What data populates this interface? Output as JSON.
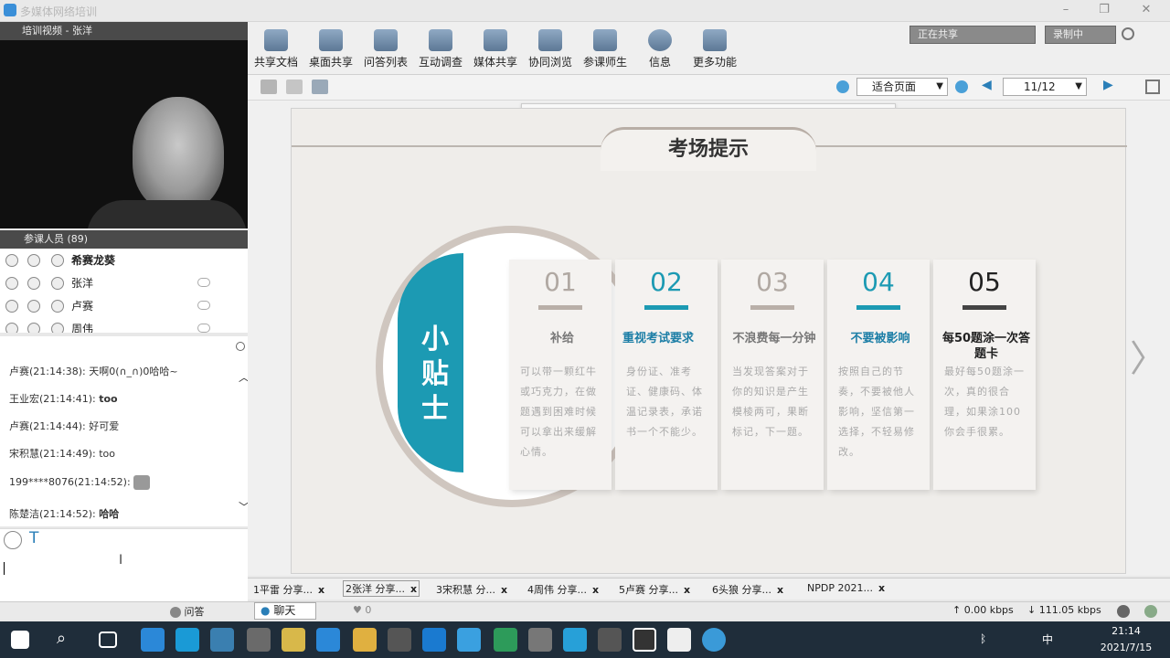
{
  "window": {
    "title": "多媒体网络培训"
  },
  "video_panel": {
    "header": "培训视频 - 张洋"
  },
  "participants": {
    "header": "参课人员 (89)",
    "items": [
      "希赛龙葵",
      "张洋",
      "卢赛",
      "周伟"
    ]
  },
  "chat": {
    "messages": [
      {
        "sender": "卢赛(21:14:38):",
        "text": "天啊0(∩_∩)0哈哈~"
      },
      {
        "sender": "王业宏(21:14:41):",
        "text": "too"
      },
      {
        "sender": "卢赛(21:14:44):",
        "text": "好可爱"
      },
      {
        "sender": "宋积慧(21:14:49):",
        "text": "too"
      },
      {
        "sender": "199****8076(21:14:52):",
        "text": ""
      },
      {
        "sender": "陈楚洁(21:14:52):",
        "text": "哈哈"
      }
    ],
    "format_icon": "T"
  },
  "toolbar": {
    "items": [
      "共享文档",
      "桌面共享",
      "问答列表",
      "互动调查",
      "媒体共享",
      "协同浏览",
      "参课师生",
      "信息",
      "更多功能"
    ],
    "status": "正在共享",
    "record": "录制中"
  },
  "doc_toolbar": {
    "zoom": "适合页面",
    "page": "11/12"
  },
  "slide": {
    "title": "考场提示",
    "badge": "小贴士",
    "cards": [
      {
        "num": "01",
        "heading": "补给",
        "body": "可以带一颗红牛或巧克力，在做题遇到困难时候可以拿出来缓解心情。"
      },
      {
        "num": "02",
        "heading": "重视考试要求",
        "body": "身份证、准考证、健康码、体温记录表，承诺书一个不能少。"
      },
      {
        "num": "03",
        "heading": "不浪费每一分钟",
        "body": "当发现答案对于你的知识是产生模棱两可，果断标记，下一题。"
      },
      {
        "num": "04",
        "heading": "不要被影响",
        "body": "按照自己的节奏，不要被他人影响，坚信第一选择，不轻易修改。"
      },
      {
        "num": "05",
        "heading": "每50题涂一次答题卡",
        "body": "最好每50题涂一次，真的很合理，如果涂100你会手很累。"
      }
    ]
  },
  "share_tabs": [
    "1平雷 分享...",
    "2张洋 分享...",
    "3宋积慧 分...",
    "4周伟 分享...",
    "5卢赛 分享...",
    "6头狼 分享...",
    "NPDP 2021..."
  ],
  "bottom_bar": {
    "qa_tab": "问答",
    "chat_tab": "聊天",
    "likes": "0",
    "upload": "0.00 kbps",
    "download": "111.05 kbps"
  },
  "taskbar": {
    "time": "21:14",
    "date": "2021/7/15",
    "lang": "中"
  }
}
